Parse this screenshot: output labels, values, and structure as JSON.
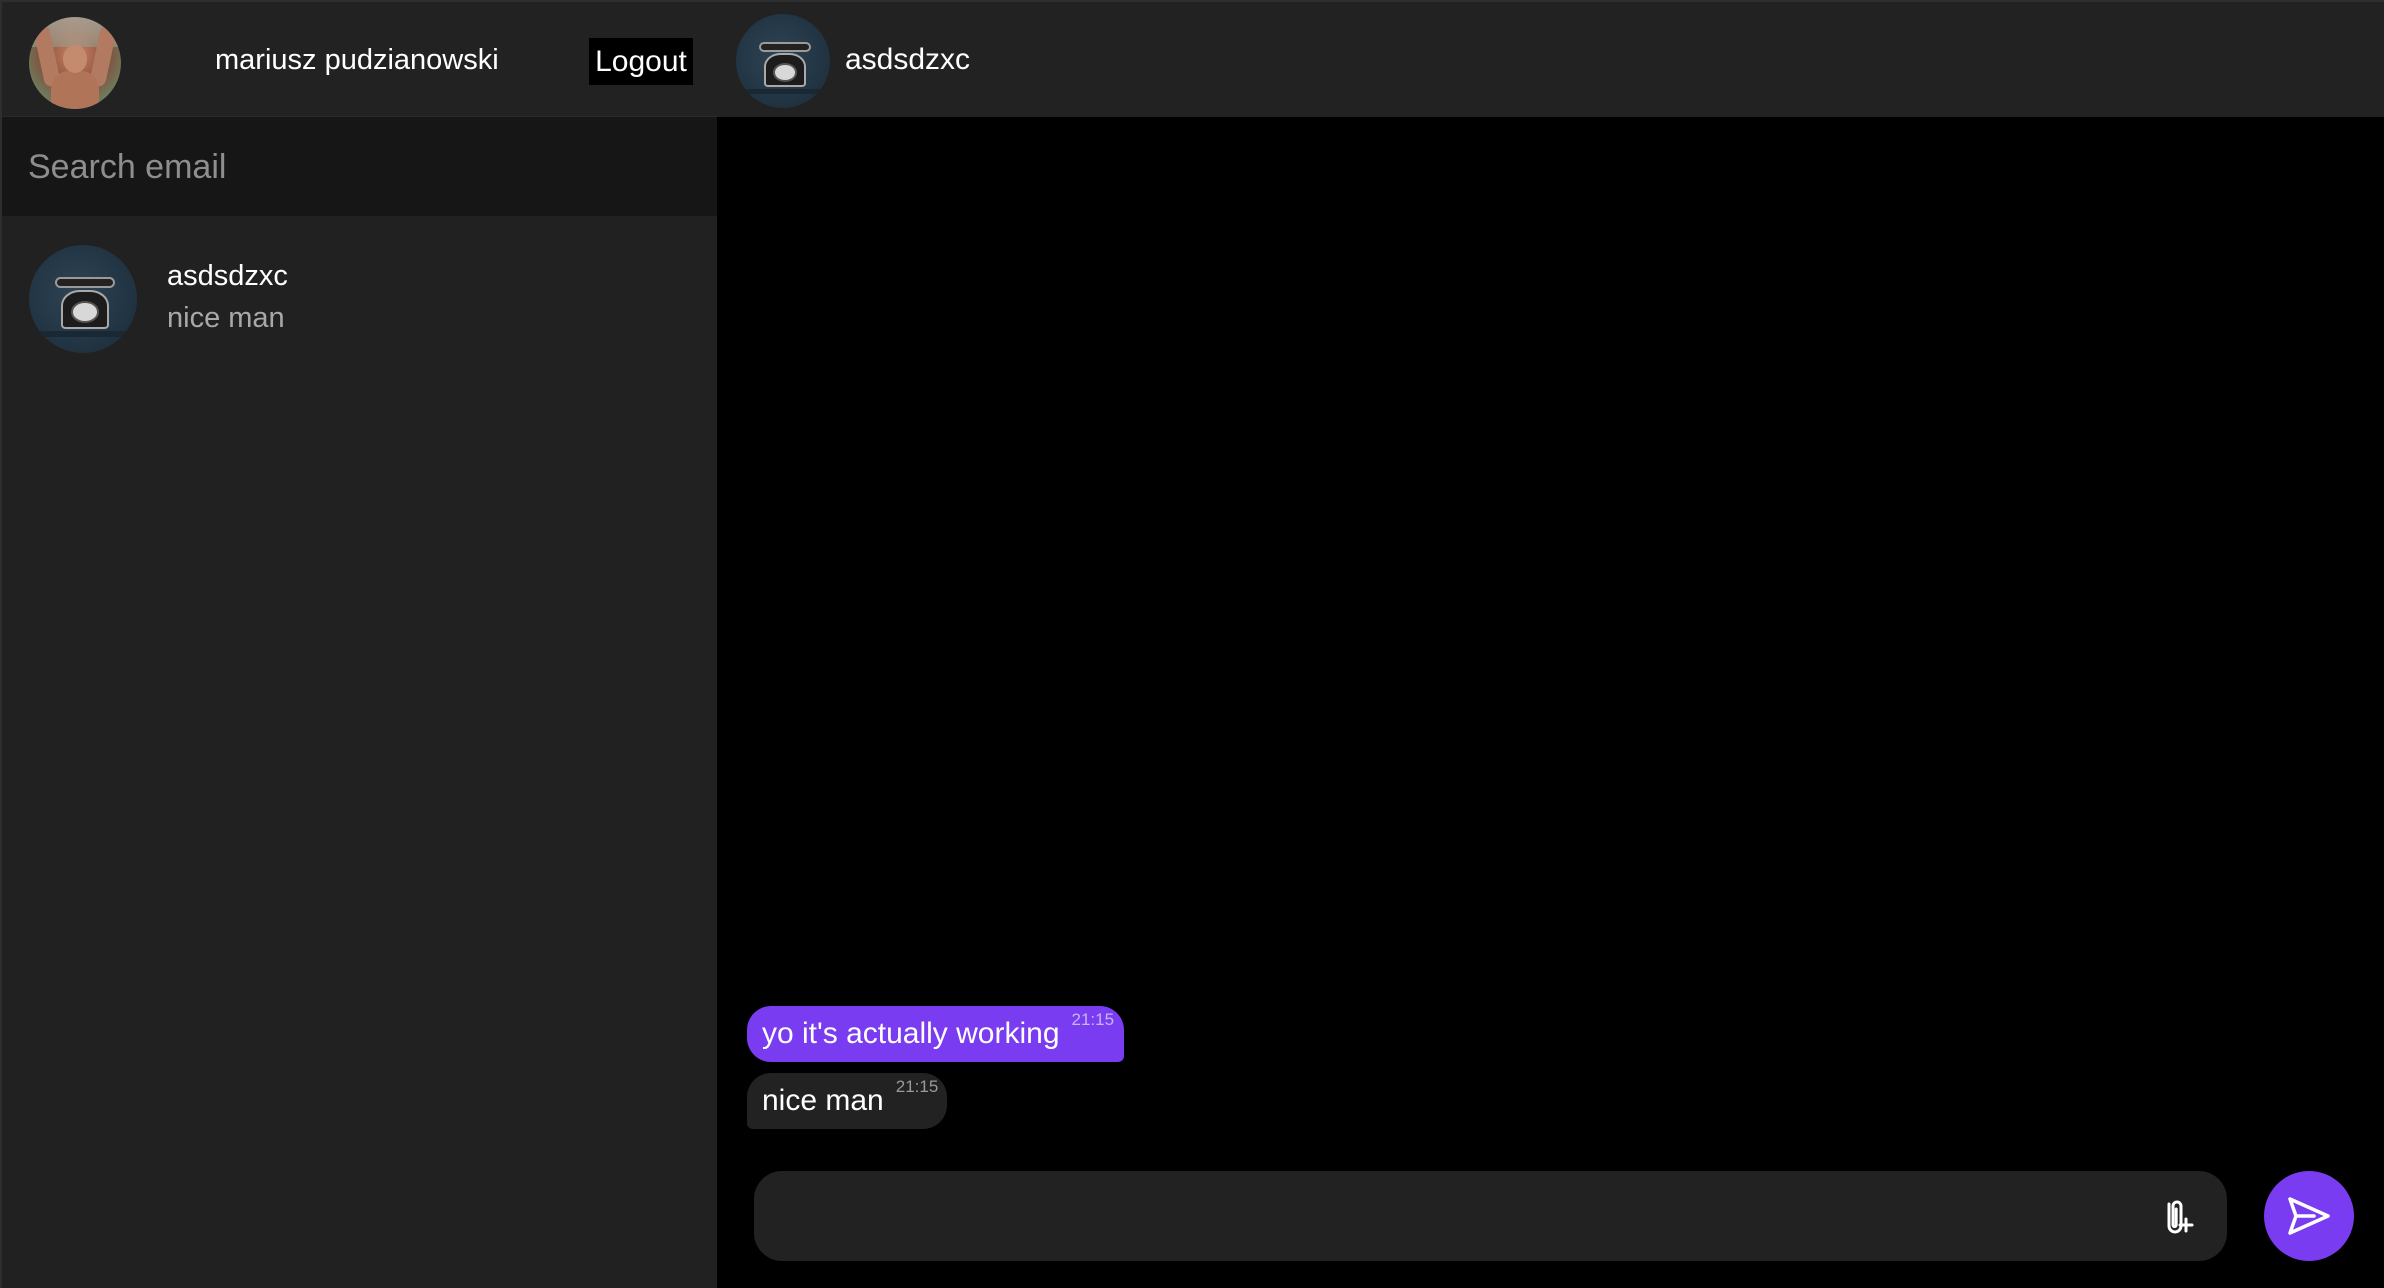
{
  "user": {
    "name": "mariusz pudzianowski",
    "avatar_icon": "user-photo-avatar"
  },
  "header": {
    "logout_label": "Logout"
  },
  "search": {
    "placeholder": "Search email",
    "value": ""
  },
  "contacts": [
    {
      "name": "asdsdzxc",
      "last_message": "nice man",
      "avatar_icon": "telephone-photo-avatar"
    }
  ],
  "chat": {
    "contact_name": "asdsdzxc",
    "avatar_icon": "telephone-photo-avatar",
    "messages": [
      {
        "direction": "sent",
        "text": "yo it's actually working",
        "time": "21:15"
      },
      {
        "direction": "received",
        "text": "nice man",
        "time": "21:15"
      }
    ]
  },
  "composer": {
    "value": "",
    "attach_icon": "paperclip-plus-icon",
    "send_icon": "send-icon"
  },
  "colors": {
    "accent": "#7a3cf0",
    "panel": "#212121",
    "background": "#000000",
    "search_bg": "#161616"
  }
}
